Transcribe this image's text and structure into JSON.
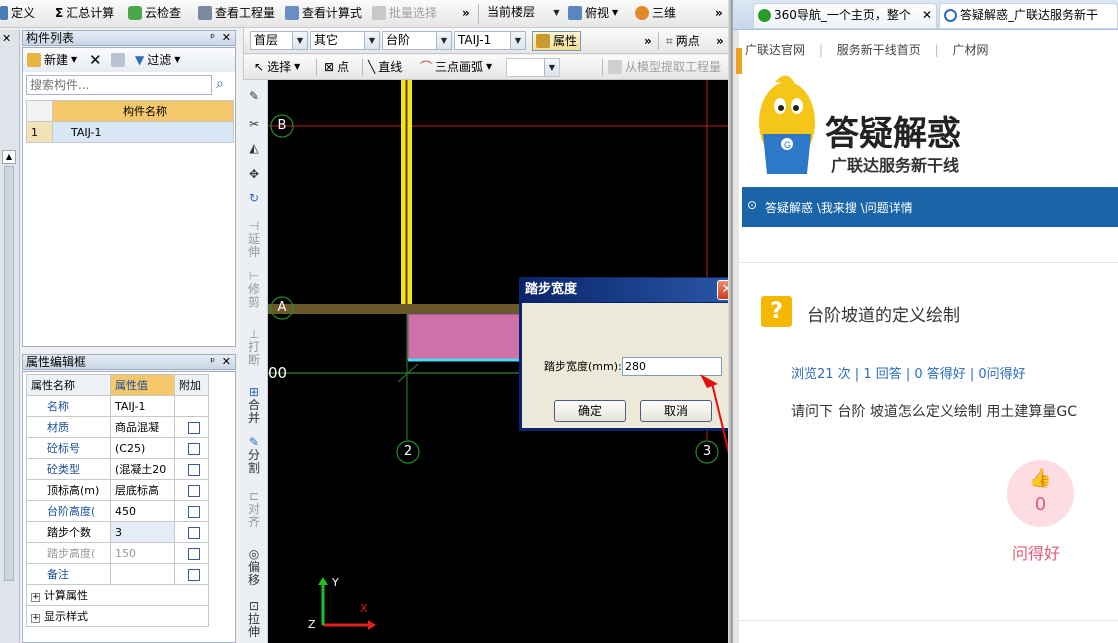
{
  "toolbar1": {
    "define": "定义",
    "summary": "汇总计算",
    "cloud_check": "云检查",
    "view_quantity": "查看工程量",
    "view_formula": "查看计算式",
    "batch_select": "批量选择",
    "overflow": "»",
    "current_floor": "当前楼层",
    "top_view": "俯视",
    "three_d": "三维"
  },
  "toolbar2": {
    "floor": "首层",
    "type": "其它",
    "category": "台阶",
    "member": "TAIJ-1",
    "property": "属性",
    "overflow": "»",
    "two_points": "两点"
  },
  "toolbar3": {
    "select": "选择",
    "point": "点",
    "line": "直线",
    "arc": "三点画弧",
    "extract": "从模型提取工程量"
  },
  "component_list": {
    "title": "构件列表",
    "new_label": "新建",
    "filter_label": "过滤",
    "search_placeholder": "搜索构件...",
    "column_header": "构件名称",
    "rows": [
      {
        "index": "1",
        "name": "TAIJ-1"
      }
    ]
  },
  "property_editor": {
    "title": "属性编辑框",
    "headers": {
      "name": "属性名称",
      "value": "属性值",
      "extra": "附加"
    },
    "rows": [
      {
        "name": "名称",
        "value": "TAIJ-1"
      },
      {
        "name": "材质",
        "value": "商品混凝"
      },
      {
        "name": "砼标号",
        "value": "(C25)"
      },
      {
        "name": "砼类型",
        "value": "(混凝土20"
      },
      {
        "name": "顶标高(m)",
        "value": "层底标高"
      },
      {
        "name": "台阶高度(",
        "value": "450"
      },
      {
        "name": "踏步个数",
        "value": "3"
      },
      {
        "name": "踏步高度(",
        "value": "150"
      },
      {
        "name": "备注",
        "value": ""
      }
    ],
    "groups": [
      "计算属性",
      "显示样式"
    ]
  },
  "vertical_tools": [
    "延伸",
    "修剪",
    "打断",
    "合并",
    "分割",
    "对齐",
    "偏移",
    "拉伸"
  ],
  "canvas": {
    "axis_b": "B",
    "axis_a": "A",
    "axis_2": "2",
    "axis_3": "3",
    "coord_label": "00",
    "ucs_y": "Y",
    "ucs_x": "X",
    "ucs_z": "Z"
  },
  "dialog": {
    "title": "踏步宽度",
    "field_label": "踏步宽度(mm):",
    "field_value": "280",
    "ok": "确定",
    "cancel": "取消"
  },
  "browser": {
    "tabs": [
      "360导航_一个主页，整个",
      "答疑解惑_广联达服务新干"
    ],
    "nav_links": [
      "广联达官网",
      "服务新干线首页",
      "广材网"
    ],
    "logo_text": "答疑解惑",
    "logo_subtitle": "广联达服务新干线",
    "breadcrumb": "答疑解惑 \\我来搜 \\问题详情",
    "question_title": "台阶坡道的定义绘制",
    "stats": "浏览21 次 | 1 回答 | 0 答得好 | 0问得好",
    "question_text": "请问下 台阶 坡道怎么定义绘制 用土建算量GC",
    "like_count": "0",
    "like_label": "问得好"
  },
  "colors": {
    "accent_blue": "#1a64a8",
    "dialog_title": "#0a246a",
    "like_pink": "#e35a76"
  }
}
